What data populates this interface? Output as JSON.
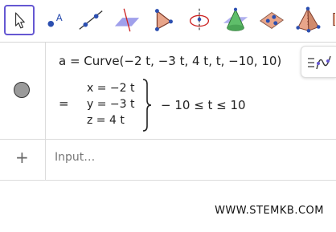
{
  "toolbar": {
    "tools": [
      {
        "name": "move-tool",
        "selected": true
      },
      {
        "name": "point-tool"
      },
      {
        "name": "line-tool"
      },
      {
        "name": "perpendicular-line-tool"
      },
      {
        "name": "polygon-tool"
      },
      {
        "name": "circle-axis-tool"
      },
      {
        "name": "cone-tool"
      },
      {
        "name": "plane-tool"
      },
      {
        "name": "pyramid-tool"
      },
      {
        "name": "net-tool"
      }
    ],
    "point_label": "A",
    "accent": "#6557d2"
  },
  "algebra": {
    "definition": "a  =  Curve(−2 t, −3 t, 4 t, t, −10, 10)",
    "equals": "=",
    "x_eq": "x = −2 t",
    "y_eq": "y = −3 t",
    "z_eq": "z = 4 t",
    "range": "− 10 ≤ t ≤ 10"
  },
  "input": {
    "plus": "+",
    "placeholder": "Input…"
  },
  "watermark": "WWW.STEMKB.COM"
}
